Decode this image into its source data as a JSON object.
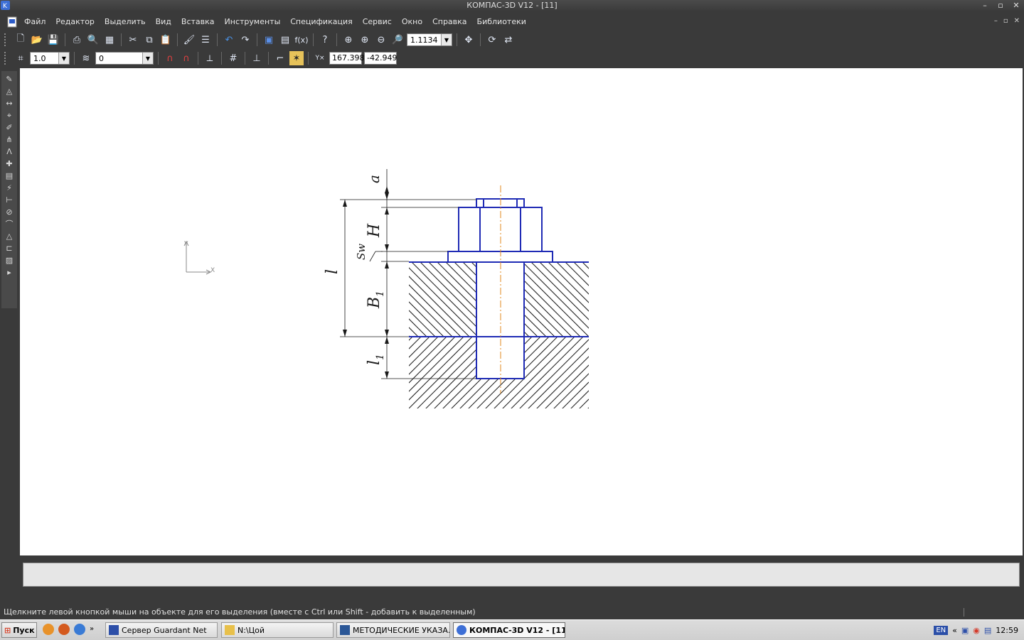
{
  "window": {
    "title": "КОМПАС-3D V12 - [11]"
  },
  "menu": {
    "items": [
      "Файл",
      "Редактор",
      "Выделить",
      "Вид",
      "Вставка",
      "Инструменты",
      "Спецификация",
      "Сервис",
      "Окно",
      "Справка",
      "Библиотеки"
    ]
  },
  "toolbar": {
    "zoom_value": "1.1134",
    "step_value": "1.0",
    "layer_value": "0",
    "coord_x": "167.398",
    "coord_y": "-42.949"
  },
  "drawing": {
    "dim_a": "a",
    "dim_H": "H",
    "dim_Sw": "Sw",
    "dim_l": "l",
    "dim_B1": "B",
    "dim_B1_sub": "1",
    "dim_l1": "l",
    "dim_l1_sub": "1",
    "axis_x": "X",
    "axis_y": "Y",
    "line_color": "#1f2bb5",
    "axis_color": "#e08a1e"
  },
  "status": {
    "hint": "Щелкните левой кнопкой мыши на объекте для его выделения (вместе с Ctrl или Shift - добавить к выделенным)"
  },
  "taskbar": {
    "start_label": "Пуск",
    "tasks": [
      {
        "label": "Сервер Guardant Net"
      },
      {
        "label": "N:\\Цой"
      },
      {
        "label": "МЕТОДИЧЕСКИЕ УКАЗА..."
      },
      {
        "label": "КОМПАС-3D V12 - [11]"
      }
    ],
    "lang": "EN",
    "clock": "12:59"
  }
}
